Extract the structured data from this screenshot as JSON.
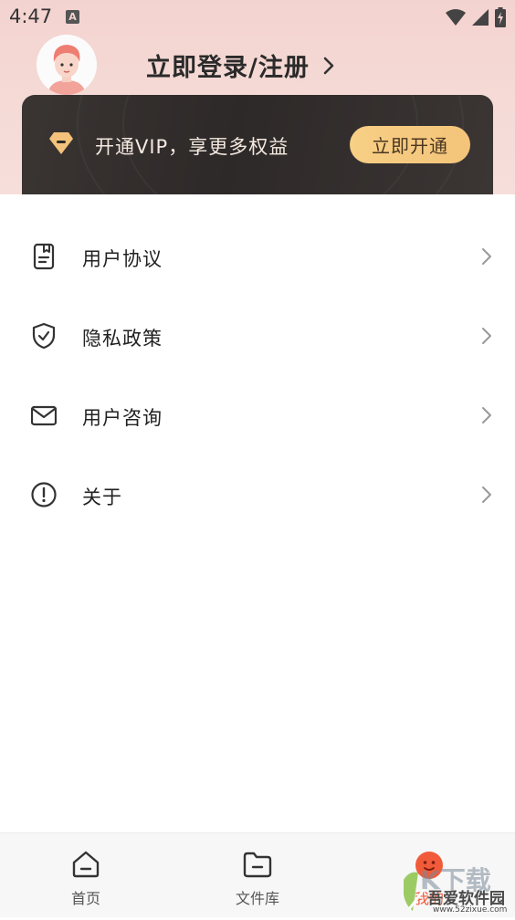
{
  "status_bar": {
    "time": "4:47",
    "notification_letter": "A"
  },
  "header": {
    "login_label": "立即登录/注册"
  },
  "vip": {
    "promo_text": "开通VIP，享更多权益",
    "button_label": "立即开通"
  },
  "menu": {
    "items": [
      {
        "label": "用户协议",
        "icon": "document-icon"
      },
      {
        "label": "隐私政策",
        "icon": "shield-check-icon"
      },
      {
        "label": "用户咨询",
        "icon": "mail-icon"
      },
      {
        "label": "关于",
        "icon": "info-icon"
      }
    ]
  },
  "bottom_nav": {
    "items": [
      {
        "label": "首页",
        "icon": "home-icon"
      },
      {
        "label": "文件库",
        "icon": "folder-icon"
      },
      {
        "label": "我的",
        "icon": "profile-face-icon"
      }
    ]
  },
  "watermark": {
    "text": "吾爱软件园",
    "url_text": "www.52zixue.com"
  },
  "colors": {
    "accent": "#f7cf85",
    "vip_card": "#2f2b29",
    "header_bg": "#f3d3cf"
  }
}
